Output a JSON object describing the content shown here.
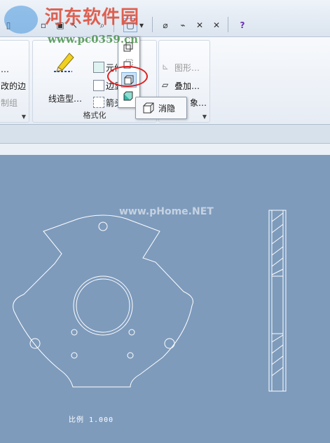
{
  "watermark": {
    "site_name": "河东软件园",
    "url": "www.pc0359.cn",
    "drawing_mark": "www.pHome.NET"
  },
  "ribbon": {
    "left_group": {
      "item1": "…",
      "item2": "改的边",
      "item3": "制组"
    },
    "format_group": {
      "line_style_label": "线造型…",
      "item_element": "元件",
      "item_edge": "边显",
      "item_arrow": "箭头",
      "group_label": "格式化"
    },
    "right_group": {
      "item_graph": "图形…",
      "item_overlay": "叠加…",
      "item_partial": "象…"
    }
  },
  "dropdown": {
    "tooltip_label": "消隐",
    "selected_index": 2
  },
  "drawing": {
    "scale_note": "比例 1.000"
  },
  "colors": {
    "canvas": "#7e9bbc",
    "highlight_ring": "#e02020",
    "drawing_lines": "#ffffff"
  }
}
